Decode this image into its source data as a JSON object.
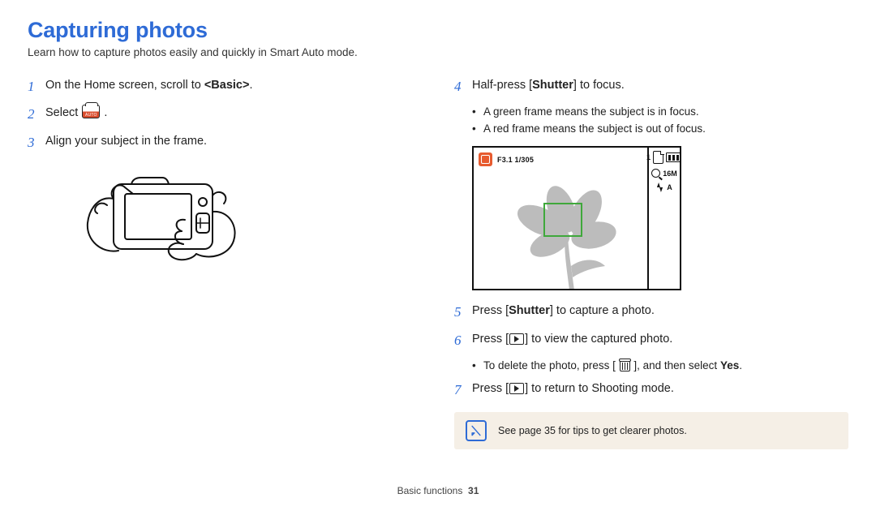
{
  "title": "Capturing photos",
  "intro": "Learn how to capture photos easily and quickly in Smart Auto mode.",
  "left": {
    "s1a": "On the Home screen, scroll to ",
    "s1b": "<Basic>",
    "s1c": ".",
    "s2a": "Select ",
    "s2b": ".",
    "s3": "Align your subject in the frame."
  },
  "right": {
    "s4a": "Half-press [",
    "s4b": "Shutter",
    "s4c": "] to focus.",
    "s4_bul1": "A green frame means the subject is in focus.",
    "s4_bul2": "A red frame means the subject is out of focus.",
    "vf_count": "1",
    "vf_exp": "F3.1  1/305",
    "vf_size": "16M",
    "vf_flash": "A",
    "s5a": "Press [",
    "s5b": "Shutter",
    "s5c": "] to capture a photo.",
    "s6a": "Press [",
    "s6b": "] to view the captured photo.",
    "s6_bul_a": "To delete the photo, press [ ",
    "s6_bul_b": " ], and then select ",
    "s6_bul_c": "Yes",
    "s6_bul_d": ".",
    "s7a": "Press [",
    "s7b": "] to return to Shooting mode."
  },
  "tip": "See page 35 for tips to get clearer photos.",
  "footer_label": "Basic functions",
  "footer_page": "31"
}
